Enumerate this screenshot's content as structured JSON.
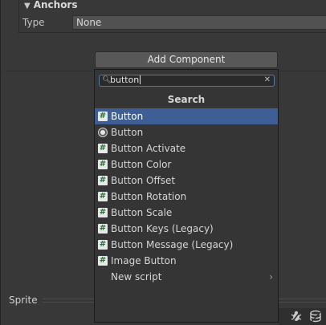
{
  "anchors": {
    "title": "Anchors",
    "type_label": "Type",
    "type_value": "None"
  },
  "add_component": {
    "button_label": "Add Component"
  },
  "search": {
    "value": "button",
    "header": "Search"
  },
  "results": [
    {
      "label": "Button",
      "icon": "script-icon",
      "selected": true
    },
    {
      "label": "Button",
      "icon": "radio-icon",
      "selected": false
    },
    {
      "label": "Button Activate",
      "icon": "script-icon",
      "selected": false
    },
    {
      "label": "Button Color",
      "icon": "script-icon",
      "selected": false
    },
    {
      "label": "Button Offset",
      "icon": "script-icon",
      "selected": false
    },
    {
      "label": "Button Rotation",
      "icon": "script-icon",
      "selected": false
    },
    {
      "label": "Button Scale",
      "icon": "script-icon",
      "selected": false
    },
    {
      "label": "Button Keys (Legacy)",
      "icon": "script-icon",
      "selected": false
    },
    {
      "label": "Button Message (Legacy)",
      "icon": "script-icon",
      "selected": false
    },
    {
      "label": "Image Button",
      "icon": "script-icon",
      "selected": false
    }
  ],
  "new_script": {
    "label": "New script"
  },
  "sprite": {
    "label": "Sprite"
  },
  "colors": {
    "selection": "#3e5f96",
    "search_border": "#3f7fcf",
    "background": "#383838"
  }
}
